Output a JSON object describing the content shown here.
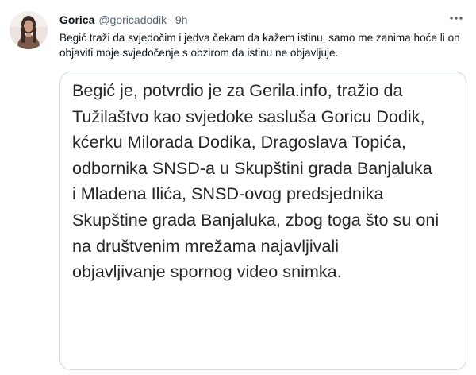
{
  "tweet": {
    "display_name": "Gorica",
    "handle": "@goricadodik",
    "separator": "·",
    "time": "9h",
    "text": "Begić traži da svjedočim i jedva čekam da kažem istinu, samo me zanima hoće li on objaviti moje svjedočenje s obzirom da istinu ne objavljuje.",
    "more_icon": "more-horizontal-icon",
    "accent_color": "#0f1419",
    "secondary_color": "#536471",
    "border_color": "#cfd9de"
  },
  "media": {
    "lines": [
      "Begić je, potvrdio je za Gerila.info, tražio da",
      "Tužilaštvo kao svjedoke sasluša Goricu Dodik,",
      "kćerku Milorada Dodika, Dragoslava Topića,",
      "odbornika SNSD-a u Skupštini grada Banjaluka",
      "i Mladena Ilića, SNSD-ovog predsjednika",
      "Skupštine grada Banjaluka, zbog toga što su oni",
      "na društvenim mrežama najavljivali",
      "objavljivanje spornog video snimka."
    ],
    "text_color": "#262626"
  }
}
